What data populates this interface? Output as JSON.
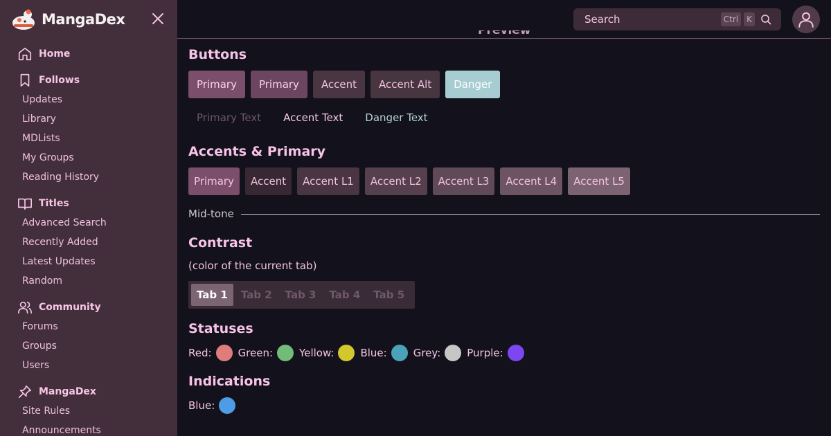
{
  "brand": {
    "name": "MangaDex"
  },
  "sidebar": {
    "sections": [
      {
        "title": "Home",
        "icon": "home-icon",
        "items": []
      },
      {
        "title": "Follows",
        "icon": "bookmark-icon",
        "items": [
          "Updates",
          "Library",
          "MDLists",
          "My Groups",
          "Reading History"
        ]
      },
      {
        "title": "Titles",
        "icon": "book-icon",
        "items": [
          "Advanced Search",
          "Recently Added",
          "Latest Updates",
          "Random"
        ]
      },
      {
        "title": "Community",
        "icon": "users-icon",
        "items": [
          "Forums",
          "Groups",
          "Users"
        ]
      },
      {
        "title": "MangaDex",
        "icon": "pin-icon",
        "items": [
          "Site Rules",
          "Announcements"
        ]
      }
    ]
  },
  "header": {
    "search_placeholder": "Search",
    "kbd_ctrl": "Ctrl",
    "kbd_k": "K",
    "preview_label": "Preview"
  },
  "main": {
    "buttons_title": "Buttons",
    "buttons": [
      {
        "label": "Primary",
        "bg": "#7b4e6b",
        "fg": "#f9d3ec"
      },
      {
        "label": "Primary",
        "bg": "#6c4560",
        "fg": "#f9d3ec"
      },
      {
        "label": "Accent",
        "bg": "#4a3642",
        "fg": "#f1c1de"
      },
      {
        "label": "Accent Alt",
        "bg": "#473540",
        "fg": "#f1c1de"
      },
      {
        "label": "Danger",
        "bg": "#a7cdd2",
        "fg": "#ffffff"
      }
    ],
    "text_buttons": [
      {
        "label": "Primary Text",
        "fg": "#6b5767"
      },
      {
        "label": "Accent Text",
        "fg": "#f4c8e6"
      },
      {
        "label": "Danger Text",
        "fg": "#b3d2d7"
      }
    ],
    "accents_title": "Accents & Primary",
    "accents": [
      {
        "label": "Primary",
        "bg": "#7b4e6b",
        "fg": "#f5c3e3"
      },
      {
        "label": "Accent",
        "bg": "#372833",
        "fg": "#f1c1de"
      },
      {
        "label": "Accent L1",
        "bg": "#4a3642",
        "fg": "#f1c1de"
      },
      {
        "label": "Accent L2",
        "bg": "#56404d",
        "fg": "#f1c1de"
      },
      {
        "label": "Accent L3",
        "bg": "#614a58",
        "fg": "#f1c1de"
      },
      {
        "label": "Accent L4",
        "bg": "#6d5463",
        "fg": "#f5c3e3"
      },
      {
        "label": "Accent L5",
        "bg": "#7c6372",
        "fg": "#f5c3e3"
      }
    ],
    "midtone_label": "Mid-tone",
    "contrast_title": "Contrast",
    "contrast_sub": "(color of the current tab)",
    "tabs": [
      "Tab 1",
      "Tab 2",
      "Tab 3",
      "Tab 4",
      "Tab 5"
    ],
    "active_tab": 0,
    "statuses_title": "Statuses",
    "statuses": [
      {
        "label": "Red:",
        "color": "#e07c7c"
      },
      {
        "label": "Green:",
        "color": "#72bb78"
      },
      {
        "label": "Yellow:",
        "color": "#d2c72c"
      },
      {
        "label": "Blue:",
        "color": "#4aa3b8"
      },
      {
        "label": "Grey:",
        "color": "#c6c6c6"
      },
      {
        "label": "Purple:",
        "color": "#7c47f0"
      }
    ],
    "indications_title": "Indications",
    "indications": [
      {
        "label": "Blue:",
        "color": "#4e9ce6"
      }
    ]
  }
}
